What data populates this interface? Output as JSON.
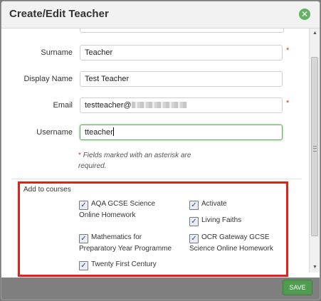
{
  "dialog": {
    "title": "Create/Edit Teacher",
    "close_icon": "close-circle-icon"
  },
  "form": {
    "surname": {
      "label": "Surname",
      "value": "Teacher",
      "required": true
    },
    "display_name": {
      "label": "Display Name",
      "value": "Test Teacher",
      "required": false
    },
    "email": {
      "label": "Email",
      "value": "testteacher@",
      "required": true
    },
    "username": {
      "label": "Username",
      "value": "tteacher",
      "required": false
    },
    "required_star": "*",
    "note_star": "*",
    "note": "Fields marked with an asterisk are required."
  },
  "courses": {
    "label": "Add to courses",
    "items": [
      {
        "name": "AQA GCSE Science Online Homework",
        "checked": true
      },
      {
        "name": "Activate",
        "checked": true
      },
      {
        "name": "Living Faiths",
        "checked": true
      },
      {
        "name": "Mathematics for Preparatory Year Programme",
        "checked": true
      },
      {
        "name": "OCR Gateway GCSE Science Online Homework",
        "checked": true
      },
      {
        "name": "Twenty First Century",
        "checked": true
      }
    ]
  },
  "footer": {
    "save_label": "SAVE"
  },
  "colors": {
    "accent": "#4f9b4f",
    "highlight": "#e2211c",
    "required": "#c0392b"
  }
}
